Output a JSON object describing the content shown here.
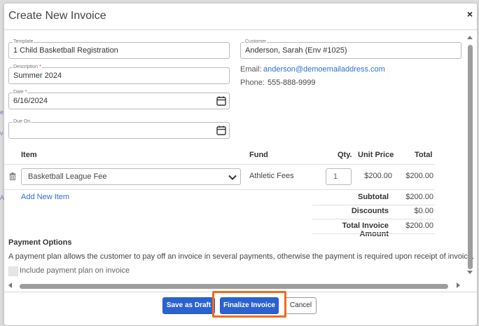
{
  "background": {
    "hints": [
      "e",
      "v",
      "A"
    ]
  },
  "modal": {
    "title": "Create New Invoice",
    "close_label": "×"
  },
  "form": {
    "template": {
      "label": "Template",
      "value": "1 Child Basketball Registration"
    },
    "description": {
      "label": "Description",
      "required": "*",
      "value": "Summer 2024"
    },
    "date": {
      "label": "Date",
      "required": "*",
      "value": "6/16/2024"
    },
    "due_on": {
      "label": "Due On",
      "value": ""
    },
    "customer": {
      "label": "Customer",
      "value": "Anderson, Sarah (Env #1025)"
    },
    "email_label": "Email:",
    "email": "anderson@demoemailaddress.com",
    "phone_label": "Phone:",
    "phone": "555-888-9999"
  },
  "table": {
    "headers": {
      "item": "Item",
      "fund": "Fund",
      "qty": "Qty.",
      "unit_price": "Unit Price",
      "total": "Total"
    },
    "rows": [
      {
        "item": "Basketball League Fee",
        "fund": "Athletic Fees",
        "qty": "1",
        "unit_price": "$200.00",
        "total": "$200.00"
      }
    ],
    "add_item": "Add New Item",
    "summary": {
      "subtotal_label": "Subtotal",
      "subtotal": "$200.00",
      "discounts_label": "Discounts",
      "discounts": "$0.00",
      "total_label": "Total Invoice Amount",
      "total": "$200.00"
    }
  },
  "payment_options": {
    "title": "Payment Options",
    "description": "A payment plan allows the customer to pay off an invoice in several payments, otherwise the payment is required upon receipt of invoice.",
    "checkbox_label": "Include payment plan on invoice",
    "checked": false
  },
  "footer": {
    "save_draft": "Save as Draft",
    "finalize": "Finalize Invoice",
    "cancel": "Cancel"
  },
  "colors": {
    "primary": "#2b62d0",
    "link": "#2e6fd3",
    "highlight": "#f26a1b"
  },
  "icons": {
    "calendar": "calendar-icon",
    "trash": "trash-icon",
    "chevron": "chevron-down-icon",
    "close": "close-icon"
  }
}
